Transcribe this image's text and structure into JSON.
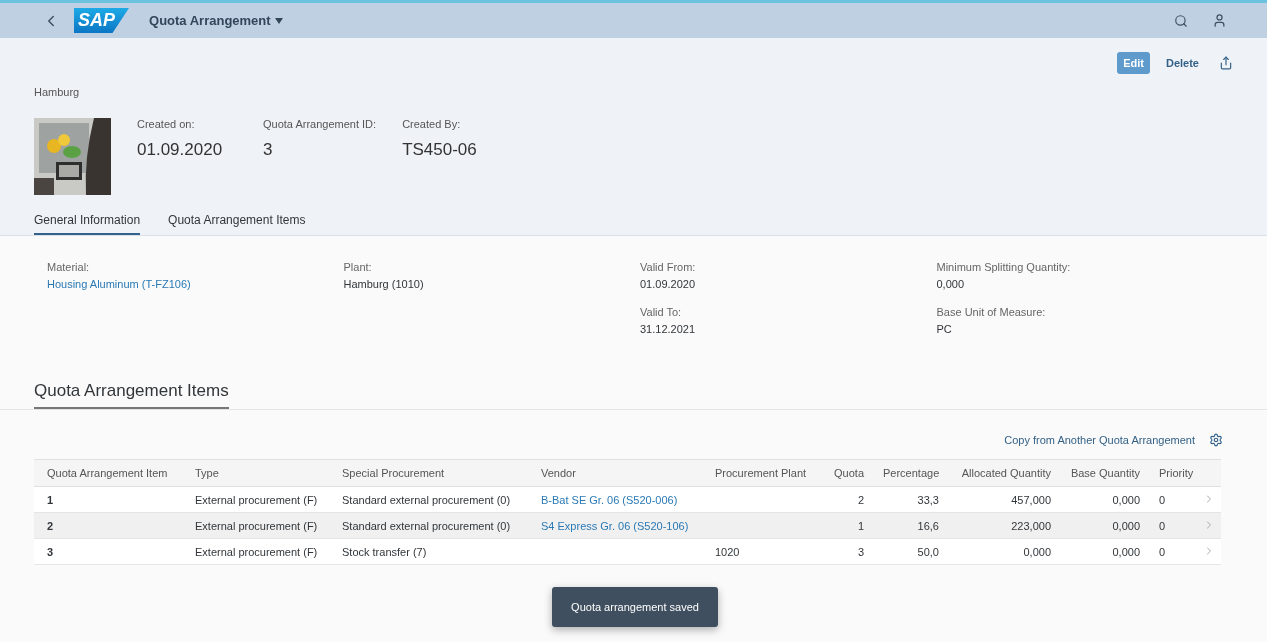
{
  "shell": {
    "title": "Quota Arrangement",
    "logo": "SAP"
  },
  "actions": [
    {
      "label": "Edit",
      "kind": "emphasized"
    },
    {
      "label": "Delete",
      "kind": "plain"
    }
  ],
  "header": {
    "subtitle": "Hamburg",
    "attributes": [
      {
        "label": "Created on:",
        "value": "01.09.2020"
      },
      {
        "label": "Quota Arrangement ID:",
        "value": "3"
      },
      {
        "label": "Created By:",
        "value": "TS450-06"
      }
    ]
  },
  "tabs": [
    {
      "label": "General Information",
      "selected": true
    },
    {
      "label": "Quota Arrangement Items",
      "selected": false
    }
  ],
  "general": [
    [
      {
        "label": "Material:",
        "value": "Housing Aluminum (T-FZ106)",
        "kind": "link"
      }
    ],
    [
      {
        "label": "Plant:",
        "value": "Hamburg (1010)",
        "kind": "text"
      }
    ],
    [
      {
        "label": "Valid From:",
        "value": "01.09.2020",
        "kind": "text"
      },
      {
        "label": "Valid To:",
        "value": "31.12.2021",
        "kind": "text"
      }
    ],
    [
      {
        "label": "Minimum Splitting Quantity:",
        "value": "0,000",
        "kind": "text"
      },
      {
        "label": "Base Unit of Measure:",
        "value": "PC",
        "kind": "text"
      }
    ]
  ],
  "section": {
    "title": "Quota Arrangement Items",
    "toolbar_action": "Copy from Another Quota Arrangement"
  },
  "table": {
    "columns": [
      "Quota Arrangement Item",
      "Type",
      "Special Procurement",
      "Vendor",
      "Procurement Plant",
      "Quota",
      "Percentage",
      "Allocated Quantity",
      "Base Quantity",
      "Priority"
    ],
    "rows": [
      {
        "cells": [
          "1",
          "External procurement (F)",
          "Standard external procurement (0)",
          "B-Bat SE Gr. 06 (S520-006)",
          "",
          "2",
          "33,3",
          "457,000",
          "0,000",
          "0"
        ],
        "hovered": false
      },
      {
        "cells": [
          "2",
          "External procurement (F)",
          "Standard external procurement (0)",
          "S4 Express Gr. 06 (S520-106)",
          "",
          "1",
          "16,6",
          "223,000",
          "0,000",
          "0"
        ],
        "hovered": true
      },
      {
        "cells": [
          "3",
          "External procurement (F)",
          "Stock transfer (7)",
          "",
          "1020",
          "3",
          "50,0",
          "0,000",
          "0,000",
          "0"
        ],
        "hovered": false
      }
    ]
  },
  "toast": "Quota arrangement saved"
}
